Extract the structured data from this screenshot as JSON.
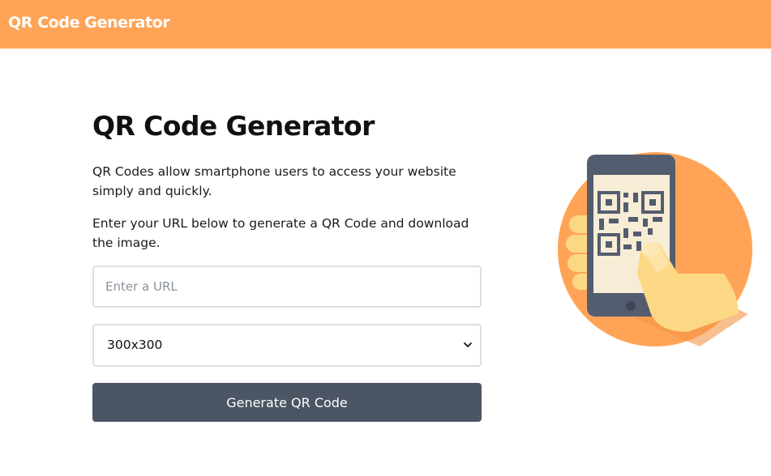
{
  "header": {
    "brand": "QR Code Generator",
    "background_color": "#ffa457"
  },
  "main": {
    "title": "QR Code Generator",
    "paragraphs": [
      "QR Codes allow smartphone users to access your website simply and quickly.",
      "Enter your URL below to generate a QR Code and download the image."
    ],
    "url_input": {
      "placeholder": "Enter a URL",
      "value": ""
    },
    "size_select": {
      "selected": "300x300",
      "icon": "chevron-down-icon"
    },
    "generate_button": {
      "label": "Generate QR Code",
      "color": "#4b5563"
    }
  },
  "illustration": {
    "icon": "phone-scanning-qr-code-icon",
    "circle_color": "#ffa457",
    "phone_color": "#545d6f",
    "hand_color": "#fdd884"
  }
}
